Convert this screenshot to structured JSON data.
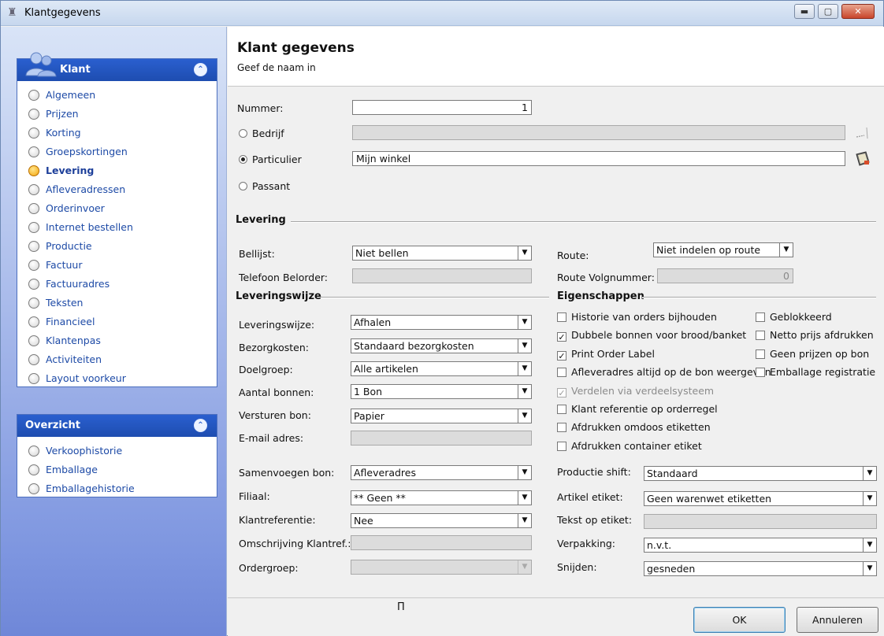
{
  "window": {
    "title": "Klantgegevens",
    "controls": {
      "minimize": "▬",
      "maximize": "▢",
      "close": "✕"
    }
  },
  "sidebar": {
    "panel1": {
      "title": "Klant",
      "collapse": "⌃",
      "items": [
        {
          "label": "Algemeen",
          "active": false
        },
        {
          "label": "Prijzen",
          "active": false
        },
        {
          "label": "Korting",
          "active": false
        },
        {
          "label": "Groepskortingen",
          "active": false
        },
        {
          "label": "Levering",
          "active": true
        },
        {
          "label": "Afleveradressen",
          "active": false
        },
        {
          "label": "Orderinvoer",
          "active": false
        },
        {
          "label": "Internet bestellen",
          "active": false
        },
        {
          "label": "Productie",
          "active": false
        },
        {
          "label": "Factuur",
          "active": false
        },
        {
          "label": "Factuuradres",
          "active": false
        },
        {
          "label": "Teksten",
          "active": false
        },
        {
          "label": "Financieel",
          "active": false
        },
        {
          "label": "Klantenpas",
          "active": false
        },
        {
          "label": "Activiteiten",
          "active": false
        },
        {
          "label": "Layout voorkeur",
          "active": false
        }
      ]
    },
    "panel2": {
      "title": "Overzicht",
      "collapse": "⌃",
      "items": [
        {
          "label": "Verkoophistorie"
        },
        {
          "label": "Emballage"
        },
        {
          "label": "Emballagehistorie"
        }
      ]
    }
  },
  "header": {
    "title": "Klant gegevens",
    "subtitle": "Geef de naam in"
  },
  "form": {
    "nummer": {
      "label": "Nummer:",
      "value": "1"
    },
    "type": {
      "bedrijf": "Bedrijf",
      "particulier": "Particulier",
      "passant": "Passant",
      "selected": "particulier",
      "particulier_value": "Mijn winkel"
    }
  },
  "levering": {
    "title": "Levering",
    "bellijst": {
      "label": "Bellijst:",
      "value": "Niet bellen"
    },
    "telefoon": {
      "label": "Telefoon Belorder:"
    },
    "route": {
      "label": "Route:",
      "value": "Niet indelen op route"
    },
    "route_volgnummer": {
      "label": "Route Volgnummer:",
      "value": "0"
    }
  },
  "leveringswijze": {
    "title": "Leveringswijze",
    "leveringswijze": {
      "label": "Leveringswijze:",
      "value": "Afhalen"
    },
    "bezorgkosten": {
      "label": "Bezorgkosten:",
      "value": "Standaard bezorgkosten"
    },
    "doelgroep": {
      "label": "Doelgroep:",
      "value": "Alle artikelen"
    },
    "aantal_bonnen": {
      "label": "Aantal bonnen:",
      "value": "1 Bon"
    },
    "versturen_bon": {
      "label": "Versturen bon:",
      "value": "Papier"
    },
    "email": {
      "label": "E-mail adres:"
    },
    "samenvoegen": {
      "label": "Samenvoegen bon:",
      "value": "Afleveradres"
    },
    "filiaal": {
      "label": "Filiaal:",
      "value": "** Geen **"
    },
    "klantreferentie": {
      "label": "Klantreferentie:",
      "value": "Nee"
    },
    "omschrijving": {
      "label": "Omschrijving Klantref.:"
    },
    "ordergroep": {
      "label": "Ordergroep:"
    }
  },
  "eigenschappen": {
    "title": "Eigenschappen",
    "left": [
      {
        "label": "Historie van orders bijhouden",
        "checked": false,
        "disabled": false
      },
      {
        "label": "Dubbele bonnen voor brood/banket",
        "checked": true,
        "disabled": false
      },
      {
        "label": "Print Order Label",
        "checked": true,
        "disabled": false
      },
      {
        "label": "Afleveradres altijd op de bon weergeven",
        "checked": false,
        "disabled": false
      },
      {
        "label": "Verdelen via verdeelsysteem",
        "checked": true,
        "disabled": true
      },
      {
        "label": "Klant referentie op orderregel",
        "checked": false,
        "disabled": false
      },
      {
        "label": "Afdrukken omdoos etiketten",
        "checked": false,
        "disabled": false
      },
      {
        "label": "Afdrukken container etiket",
        "checked": false,
        "disabled": false
      }
    ],
    "right": [
      {
        "label": "Geblokkeerd",
        "checked": false
      },
      {
        "label": "Netto prijs afdrukken",
        "checked": false
      },
      {
        "label": "Geen prijzen op bon",
        "checked": false
      },
      {
        "label": "Emballage registratie",
        "checked": false
      }
    ]
  },
  "productie": {
    "shift": {
      "label": "Productie shift:",
      "value": "Standaard"
    },
    "artikel_etiket": {
      "label": "Artikel etiket:",
      "value": "Geen warenwet etiketten"
    },
    "tekst_op_etiket": {
      "label": "Tekst op etiket:"
    },
    "verpakking": {
      "label": "Verpakking:",
      "value": "n.v.t."
    },
    "snijden": {
      "label": "Snijden:",
      "value": "gesneden"
    }
  },
  "buttons": {
    "ok": "OK",
    "cancel": "Annuleren"
  },
  "cursor": "Π"
}
